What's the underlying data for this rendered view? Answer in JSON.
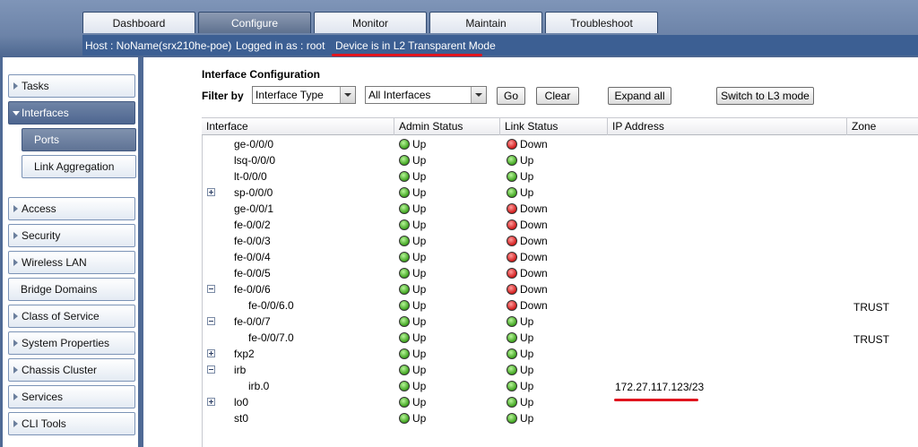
{
  "tabs": [
    {
      "label": "Dashboard",
      "active": false
    },
    {
      "label": "Configure",
      "active": true
    },
    {
      "label": "Monitor",
      "active": false
    },
    {
      "label": "Maintain",
      "active": false
    },
    {
      "label": "Troubleshoot",
      "active": false
    }
  ],
  "status": {
    "host": "Host : NoName(srx210he-poe)",
    "logged_in": "Logged in as : root",
    "mode": "Device is in L2 Transparent Mode"
  },
  "sidebar": {
    "items": [
      {
        "label": "Tasks"
      },
      {
        "label": "Interfaces"
      },
      {
        "label": "Ports"
      },
      {
        "label": "Link Aggregation"
      },
      {
        "label": "Access"
      },
      {
        "label": "Security"
      },
      {
        "label": "Wireless LAN"
      },
      {
        "label": "Bridge Domains"
      },
      {
        "label": "Class of Service"
      },
      {
        "label": "System Properties"
      },
      {
        "label": "Chassis Cluster"
      },
      {
        "label": "Services"
      },
      {
        "label": "CLI Tools"
      }
    ]
  },
  "main": {
    "title": "Interface Configuration",
    "filter_label": "Filter by",
    "filter_type": "Interface Type",
    "filter_value": "All Interfaces",
    "buttons": {
      "go": "Go",
      "clear": "Clear",
      "expand_all": "Expand all",
      "switch_l3": "Switch to L3 mode"
    }
  },
  "table": {
    "columns": [
      "Interface",
      "Admin Status",
      "Link Status",
      "IP Address",
      "Zone"
    ],
    "rows": [
      {
        "name": "ge-0/0/0",
        "admin": "Up",
        "link": "Down",
        "ip": "",
        "zone": ""
      },
      {
        "name": "lsq-0/0/0",
        "admin": "Up",
        "link": "Up",
        "ip": "",
        "zone": ""
      },
      {
        "name": "lt-0/0/0",
        "admin": "Up",
        "link": "Up",
        "ip": "",
        "zone": ""
      },
      {
        "name": "sp-0/0/0",
        "admin": "Up",
        "link": "Up",
        "ip": "",
        "zone": ""
      },
      {
        "name": "ge-0/0/1",
        "admin": "Up",
        "link": "Down",
        "ip": "",
        "zone": ""
      },
      {
        "name": "fe-0/0/2",
        "admin": "Up",
        "link": "Down",
        "ip": "",
        "zone": ""
      },
      {
        "name": "fe-0/0/3",
        "admin": "Up",
        "link": "Down",
        "ip": "",
        "zone": ""
      },
      {
        "name": "fe-0/0/4",
        "admin": "Up",
        "link": "Down",
        "ip": "",
        "zone": ""
      },
      {
        "name": "fe-0/0/5",
        "admin": "Up",
        "link": "Down",
        "ip": "",
        "zone": ""
      },
      {
        "name": "fe-0/0/6",
        "admin": "Up",
        "link": "Down",
        "ip": "",
        "zone": ""
      },
      {
        "name": "fe-0/0/6.0",
        "admin": "Up",
        "link": "Down",
        "ip": "",
        "zone": "TRUST"
      },
      {
        "name": "fe-0/0/7",
        "admin": "Up",
        "link": "Up",
        "ip": "",
        "zone": ""
      },
      {
        "name": "fe-0/0/7.0",
        "admin": "Up",
        "link": "Up",
        "ip": "",
        "zone": "TRUST"
      },
      {
        "name": "fxp2",
        "admin": "Up",
        "link": "Up",
        "ip": "",
        "zone": ""
      },
      {
        "name": "irb",
        "admin": "Up",
        "link": "Up",
        "ip": "",
        "zone": ""
      },
      {
        "name": "irb.0",
        "admin": "Up",
        "link": "Up",
        "ip": "172.27.117.123/23",
        "zone": ""
      },
      {
        "name": "lo0",
        "admin": "Up",
        "link": "Up",
        "ip": "",
        "zone": ""
      },
      {
        "name": "st0",
        "admin": "Up",
        "link": "Up",
        "ip": "",
        "zone": ""
      }
    ]
  }
}
